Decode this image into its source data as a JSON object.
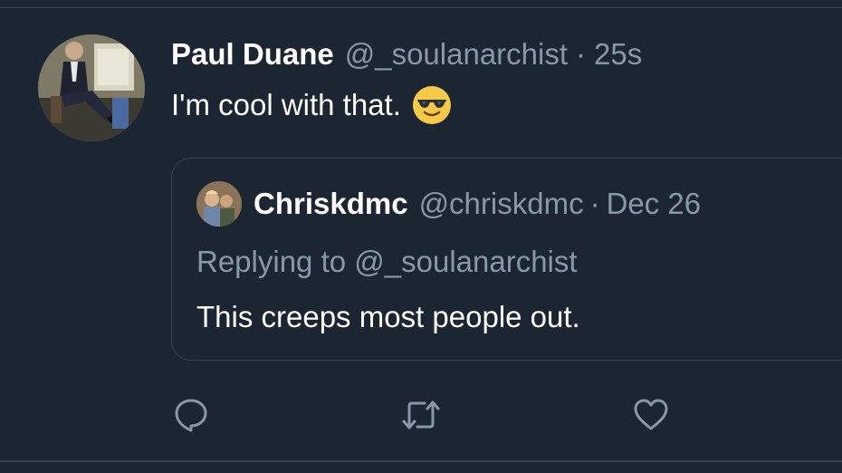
{
  "tweet": {
    "author_name": "Paul Duane",
    "author_handle": "@_soulanarchist",
    "separator": "·",
    "timestamp": "25s",
    "text": "I'm cool with that.",
    "emoji": "smiling-face-with-sunglasses-icon"
  },
  "quoted_tweet": {
    "author_name": "Chriskdmc",
    "author_handle": "@chriskdmc",
    "separator": "·",
    "date": "Dec 26",
    "replying_to": "Replying to @_soulanarchist",
    "text": "This creeps most people out."
  },
  "actions": [
    {
      "name": "reply",
      "icon": "reply-icon"
    },
    {
      "name": "retweet",
      "icon": "retweet-icon"
    },
    {
      "name": "like",
      "icon": "heart-icon"
    }
  ],
  "colors": {
    "background": "#1c2532",
    "primary_text": "#ffffff",
    "secondary_text": "#8899a6",
    "border": "#38444d",
    "emoji_yellow": "#f7c948"
  }
}
